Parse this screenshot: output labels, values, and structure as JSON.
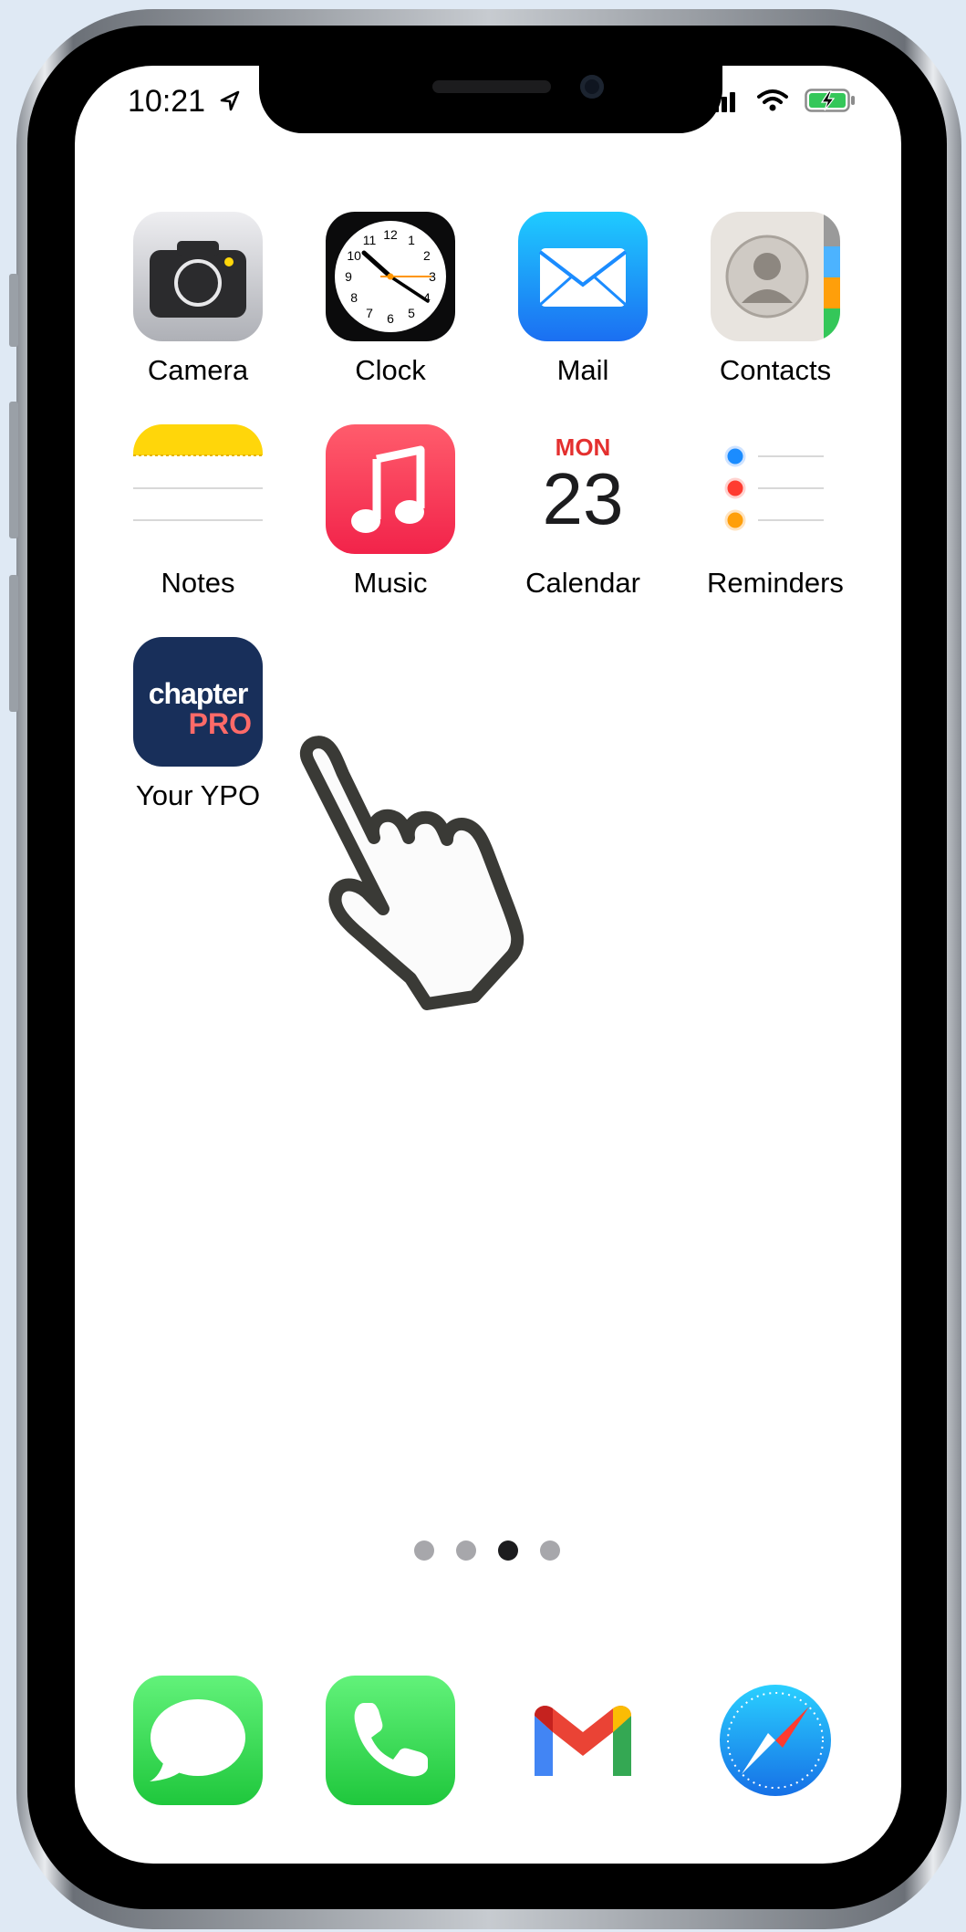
{
  "status_bar": {
    "time": "10:21"
  },
  "apps": [
    {
      "label": "Camera"
    },
    {
      "label": "Clock"
    },
    {
      "label": "Mail"
    },
    {
      "label": "Contacts"
    },
    {
      "label": "Notes"
    },
    {
      "label": "Music"
    },
    {
      "label": "Calendar"
    },
    {
      "label": "Reminders"
    },
    {
      "label": "Your YPO"
    }
  ],
  "calendar_icon": {
    "day": "MON",
    "date": "23"
  },
  "chapter_icon": {
    "line1": "chapter",
    "line2": "PRO"
  },
  "clock_icon": {
    "numbers": [
      "12",
      "1",
      "2",
      "3",
      "4",
      "5",
      "6",
      "7",
      "8",
      "9",
      "10",
      "11"
    ]
  },
  "page_indicator": {
    "count": 4,
    "active_index": 2
  },
  "dock": [
    {
      "icon": "messages-icon"
    },
    {
      "icon": "phone-icon"
    },
    {
      "icon": "gmail-icon"
    },
    {
      "icon": "safari-icon"
    }
  ],
  "colors": {
    "accent_red": "#e4302f",
    "ios_green": "#34c759",
    "ios_blue": "#1b8cff"
  }
}
